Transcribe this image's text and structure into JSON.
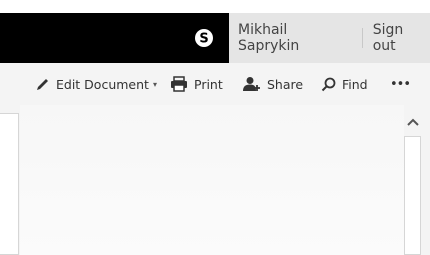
{
  "suite_bar": {
    "skype_icon": "skype-icon",
    "user_name": "Mikhail Saprykin",
    "sign_out": "Sign out"
  },
  "toolbar": {
    "edit": {
      "label": "Edit Document",
      "icon": "pencil-icon",
      "caret": "▾"
    },
    "print": {
      "label": "Print",
      "icon": "printer-icon"
    },
    "share": {
      "label": "Share",
      "icon": "person-add-icon"
    },
    "find": {
      "label": "Find",
      "icon": "search-icon"
    },
    "more": {
      "label": "•••",
      "icon": "more-icon"
    }
  },
  "scrollbar": {
    "up_icon": "chevron-up-icon"
  }
}
